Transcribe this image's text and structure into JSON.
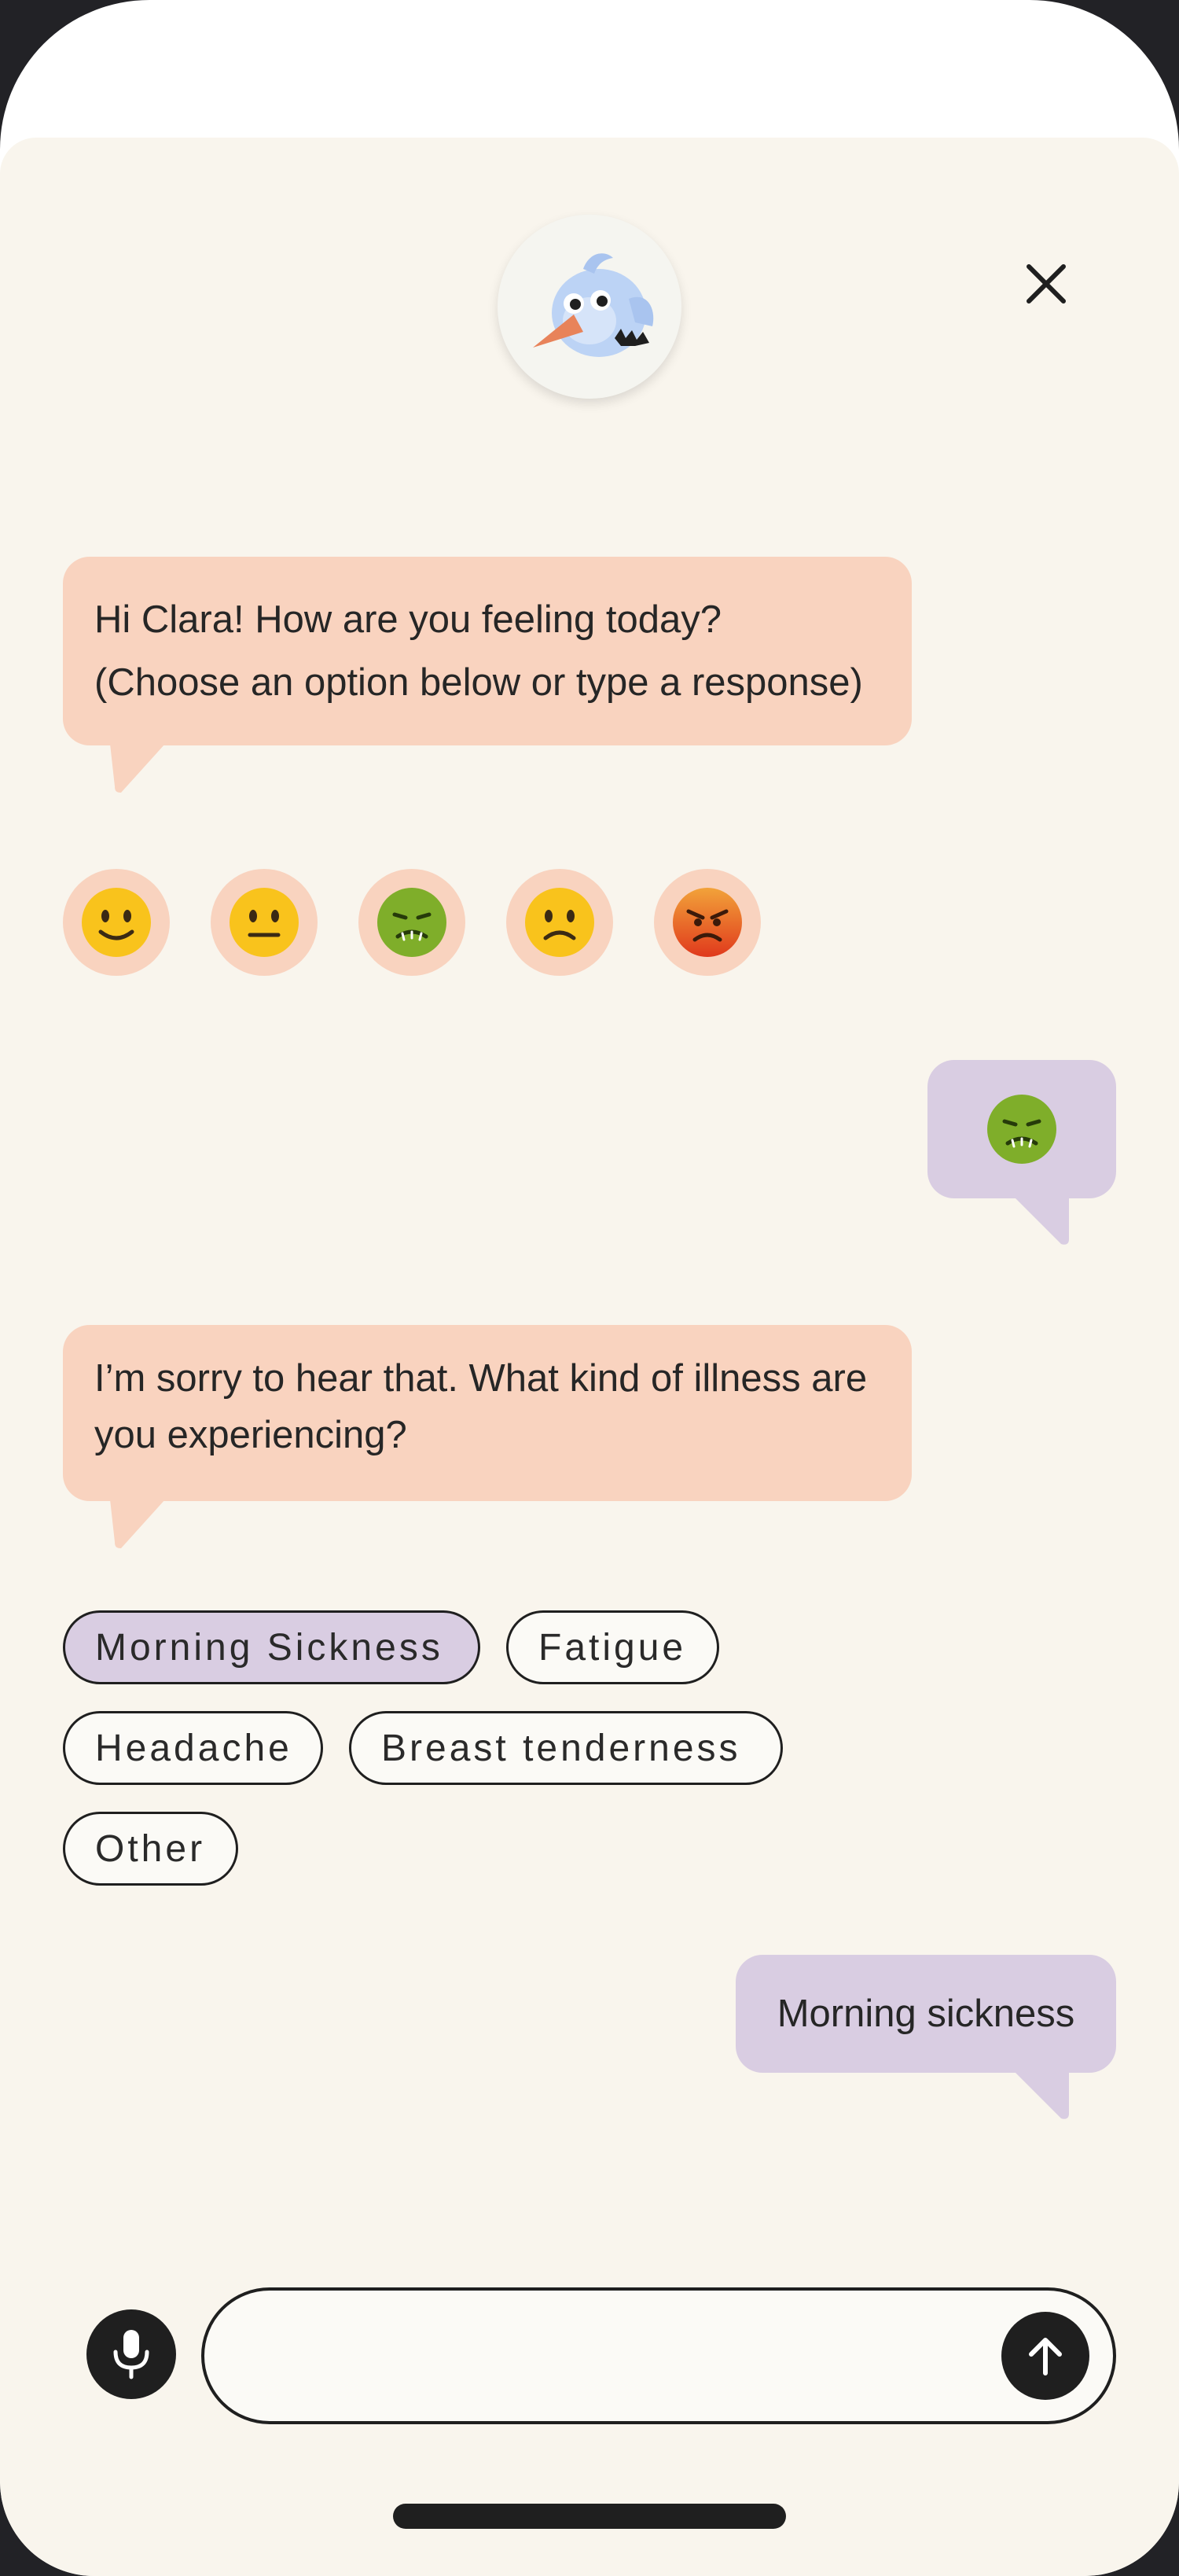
{
  "header": {
    "avatar_icon": "bird-mascot-icon",
    "close_icon": "close-icon"
  },
  "messages": {
    "greeting_line1": "Hi Clara! How are you feeling today?",
    "greeting_line2": "(Choose an option below or type a response)",
    "mood_reply_icon": "nauseated-face-emoji",
    "followup": "I’m sorry to hear that. What kind of illness are you experiencing?",
    "illness_reply": "Morning sickness"
  },
  "moods": [
    {
      "icon": "slightly-smiling-face-emoji"
    },
    {
      "icon": "neutral-face-emoji"
    },
    {
      "icon": "nauseated-face-emoji"
    },
    {
      "icon": "slightly-frowning-face-emoji"
    },
    {
      "icon": "pouting-face-emoji"
    }
  ],
  "chips": [
    {
      "label": "Morning Sickness",
      "selected": true
    },
    {
      "label": "Fatigue",
      "selected": false
    },
    {
      "label": "Headache",
      "selected": false
    },
    {
      "label": "Breast tenderness",
      "selected": false
    },
    {
      "label": "Other",
      "selected": false
    }
  ],
  "composer": {
    "input_value": "",
    "placeholder": "",
    "mic_icon": "microphone-icon",
    "send_icon": "arrow-up-icon"
  },
  "colors": {
    "background": "#f9f5ed",
    "bot_bubble": "#f9d3bf",
    "user_bubble": "#d9cde2",
    "dark": "#1f1f1f"
  }
}
